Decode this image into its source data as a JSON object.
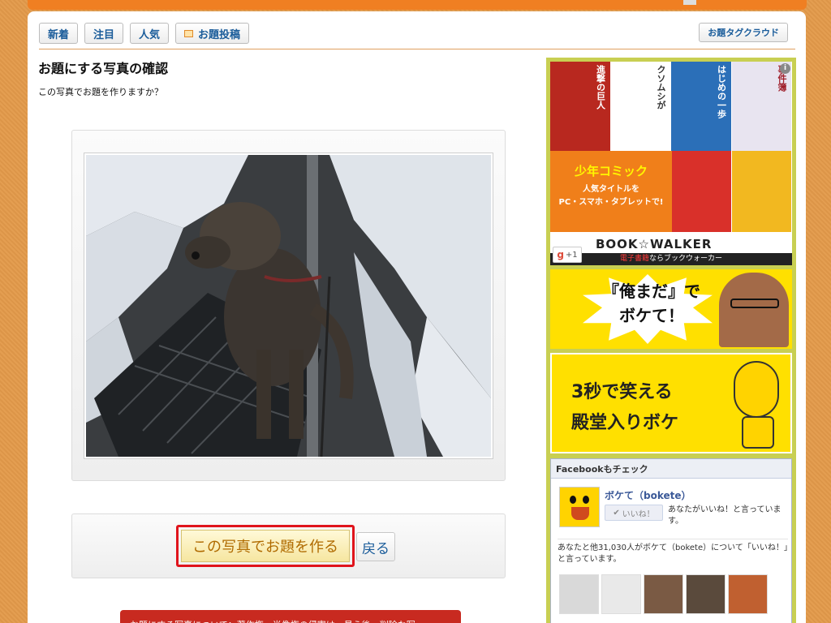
{
  "colors": {
    "accent": "#f07f22",
    "link": "#1a5c9a",
    "highlight": "#e0141c",
    "sidebar": "#c8cf52"
  },
  "tabs": [
    {
      "label": "新着"
    },
    {
      "label": "注目"
    },
    {
      "label": "人気"
    },
    {
      "label": "お題投稿",
      "icon": "image-icon"
    }
  ],
  "tag_cloud_label": "お題タグクラウド",
  "page": {
    "title": "お題にする写真の確認",
    "subtitle": "この写真でお題を作りますか？"
  },
  "actions": {
    "make_label": "この写真でお題を作る",
    "back_label": "戻る"
  },
  "notice_text": "お題にする写真について：著作権・肖像権の侵害は、見え後、削除な写",
  "sidebar": {
    "comic_ad": {
      "covers": [
        "進撃の巨人",
        "クソムシが",
        "はじめの一歩",
        "事件簿"
      ],
      "headline": "少年コミック",
      "line1": "人気タイトルを",
      "line2": "PC・スマホ・タブレットで!",
      "logo": "BOOK☆WALKER",
      "strip_red": "電子書籍",
      "strip_white": "ならブックウォーカー",
      "gplus": "+1",
      "info": "i"
    },
    "banner1_text1": "『俺まだ』で",
    "banner1_text2": "ボケて！",
    "banner2_text1": "3秒で笑える",
    "banner2_text2": "殿堂入りボケ",
    "facebook": {
      "header": "Facebookもチェック",
      "name": "ボケて（bokete）",
      "like_button": "いいね！",
      "like_text": "あなたがいいね！と言っています。",
      "count_text": "あなたと他31,030人がボケて（bokete）について「いいね！」と言っています。"
    }
  }
}
